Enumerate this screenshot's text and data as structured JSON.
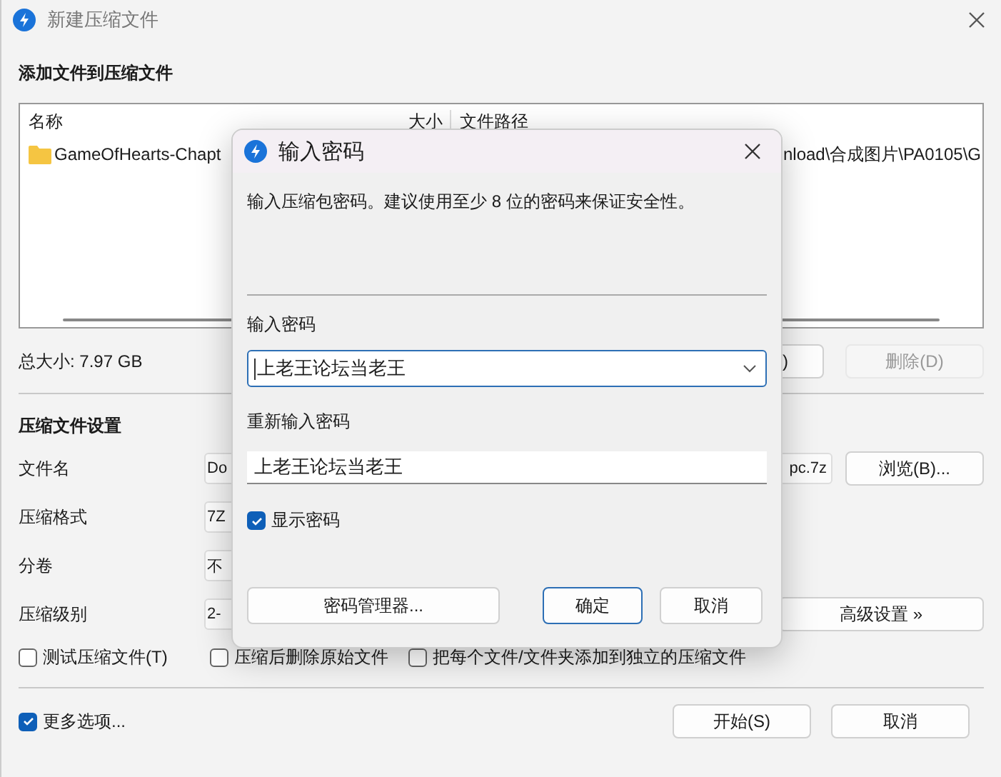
{
  "window": {
    "title": "新建压缩文件"
  },
  "files_section": {
    "heading": "添加文件到压缩文件",
    "columns": [
      "名称",
      "大小",
      "文件路径"
    ],
    "rows": [
      {
        "name": "GameOfHearts-Chapt",
        "path": "nload\\合成图片\\PA0105\\G"
      }
    ],
    "total": "总大小: 7.97 GB",
    "buttons": [
      {
        "label": ")",
        "disabled": false
      },
      {
        "label": "删除(D)",
        "disabled": true
      }
    ]
  },
  "settings": {
    "heading": "压缩文件设置",
    "fields": [
      {
        "label": "文件名",
        "value": "Do",
        "value_end": "pc.7z",
        "button": "浏览(B)..."
      },
      {
        "label": "压缩格式",
        "value": "7Z"
      },
      {
        "label": "分卷",
        "value": "不"
      },
      {
        "label": "压缩级别",
        "value": "2-",
        "button": "高级设置 »"
      }
    ]
  },
  "options": [
    {
      "label": "测试压缩文件(T)",
      "checked": false
    },
    {
      "label": "压缩后删除原始文件",
      "checked": false
    },
    {
      "label": "把每个文件/文件夹添加到独立的压缩文件",
      "checked": false
    }
  ],
  "more_options": {
    "label": "更多选项...",
    "checked": true
  },
  "footer_buttons": [
    "开始(S)",
    "取消"
  ],
  "dialog": {
    "title": "输入密码",
    "description": "输入压缩包密码。建议使用至少 8 位的密码来保证安全性。",
    "password_label": "输入密码",
    "password": "上老王论坛当老王",
    "confirm_label": "重新输入密码",
    "confirm": "上老王论坛当老王",
    "show_password": {
      "label": "显示密码",
      "checked": true
    },
    "buttons": [
      {
        "label": "密码管理器...",
        "default": false
      },
      {
        "label": "确定",
        "default": true
      },
      {
        "label": "取消",
        "default": false
      }
    ]
  }
}
